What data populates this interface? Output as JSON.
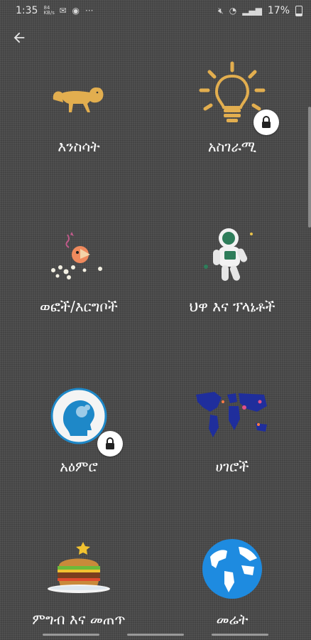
{
  "status_bar": {
    "time": "1:35",
    "small_text": "84 KB/s",
    "extra": "···",
    "battery": "17%"
  },
  "categories": [
    {
      "label": "እንስሳት",
      "icon": "lion-icon",
      "locked": false
    },
    {
      "label": "አስገራሚ",
      "icon": "lightbulb-icon",
      "locked": true
    },
    {
      "label": "ወፎች/እርግቦች",
      "icon": "bird-icon",
      "locked": false
    },
    {
      "label": "ህዋ እና ፕላኔቶች",
      "icon": "astronaut-icon",
      "locked": false
    },
    {
      "label": "አዕምሮ",
      "icon": "brain-head-icon",
      "locked": true
    },
    {
      "label": "ሀገሮች",
      "icon": "world-map-icon",
      "locked": false
    },
    {
      "label": "ምግብ እና መጠጥ",
      "icon": "burger-icon",
      "locked": false
    },
    {
      "label": "መሬት",
      "icon": "earth-globe-icon",
      "locked": false
    }
  ],
  "colors": {
    "accent_gold": "#e2ae4f",
    "earth_blue": "#1e8be0",
    "map_blue": "#1f2e9c"
  }
}
